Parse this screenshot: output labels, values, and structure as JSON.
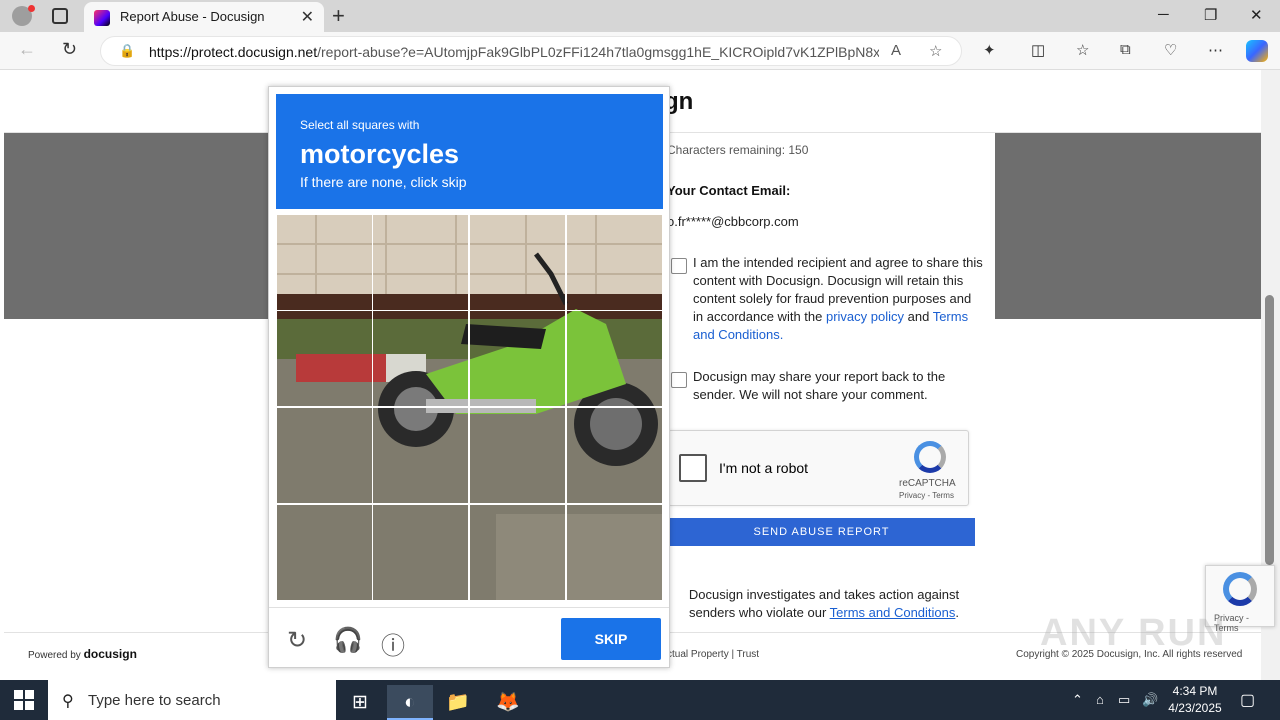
{
  "browser": {
    "tab_title": "Report Abuse - Docusign",
    "new_tab_icon": "+",
    "url_host": "https://protect.docusign.net",
    "url_path": "/report-abuse?e=AUtomjpFak9GlbPL0zFFi124h7tla0gmsgg1hE_KICROipld7vK1ZPlBpN8x...",
    "window_controls": [
      "─",
      "❐",
      "✕"
    ]
  },
  "page": {
    "logo_fragment": "gn",
    "chars_remaining": "Characters remaining: 150",
    "contact_label": "Your Contact Email:",
    "contact_email": "o.fr*****@cbbcorp.com",
    "consent1_text_a": "I am the intended recipient and agree to share this content with Docusign. Docusign will retain this content solely for fraud prevention purposes and in accordance with the ",
    "consent1_link1": "privacy policy",
    "consent1_and": " and ",
    "consent1_link2": "Terms and Conditions.",
    "consent2_text": "Docusign may share your report back to the sender. We will not share your comment.",
    "recaptcha_label": "I'm not a robot",
    "recaptcha_brand": "reCAPTCHA",
    "recaptcha_terms": "Privacy - Terms",
    "send_button": "SEND ABUSE REPORT",
    "investigate_text": "Docusign investigates and takes action against senders who violate our ",
    "investigate_link": "Terms and Conditions",
    "investigate_end": "."
  },
  "footer": {
    "powered_by": "Powered by",
    "powered_brand": "docusign",
    "links": "ctual Property   |   Trust",
    "copyright": "Copyright © 2025 Docusign, Inc. All rights reserved"
  },
  "badge": {
    "terms": "Privacy - Terms"
  },
  "watermark": "ANY RUN",
  "challenge": {
    "select_text": "Select all squares with",
    "object": "motorcycles",
    "skip_note": "If there are none, click skip",
    "skip_button": "SKIP",
    "tools": [
      "reload-icon",
      "audio-icon",
      "info-icon"
    ]
  },
  "taskbar": {
    "search_placeholder": "Type here to search",
    "time": "4:34 PM",
    "date": "4/23/2025"
  }
}
